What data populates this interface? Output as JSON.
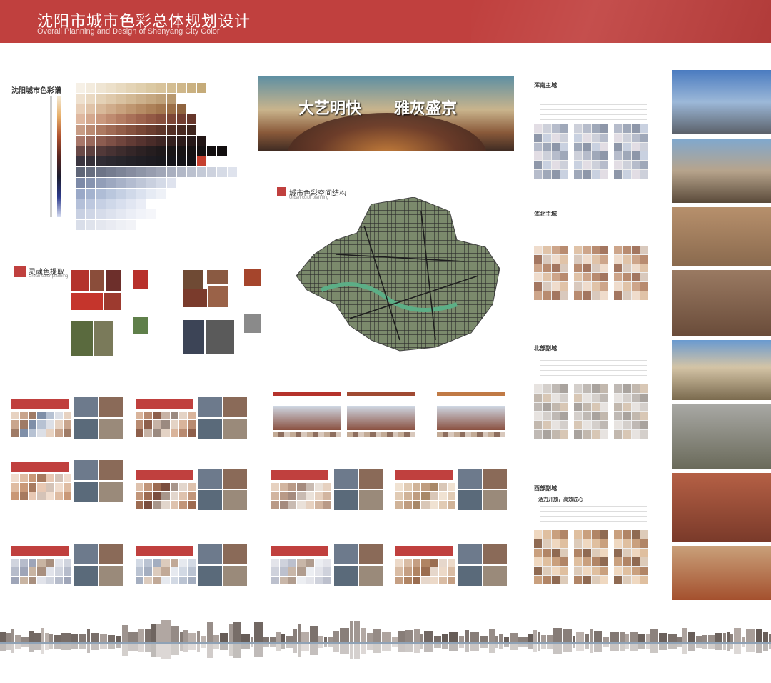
{
  "header": {
    "title_cn": "沈阳市城市色彩总体规划设计",
    "title_en": "Overall Planning and Design of Shenyang City Color"
  },
  "spectrum": {
    "label": "沈阳城市色彩谱"
  },
  "hero": {
    "slogan_left": "大艺明快",
    "slogan_right": "雅灰盛京"
  },
  "map": {
    "label_cn": "城市色彩空间结构",
    "label_en": "Urban color planning"
  },
  "soul": {
    "label_cn": "灵魂色提取",
    "label_en": "Urban color planning"
  },
  "panels_right": [
    {
      "title": "浑南主城"
    },
    {
      "title": "浑北主城"
    },
    {
      "title": "北部副城"
    },
    {
      "title": "西部副城",
      "subtitle": "活力开放，高效匠心"
    }
  ],
  "colors": {
    "brand_red": "#c0403e"
  }
}
